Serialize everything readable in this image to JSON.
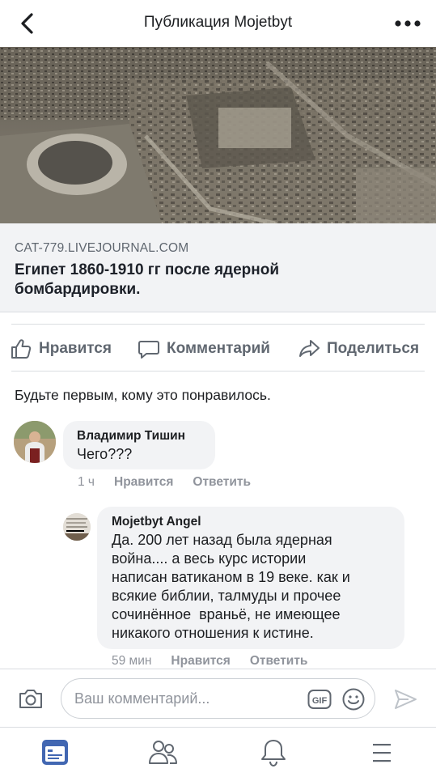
{
  "header": {
    "title": "Публикация Mojetbyt"
  },
  "link_card": {
    "domain": "CAT-779.LIVEJOURNAL.COM",
    "title": "Египет 1860-1910 гг после ядерной бомбардировки."
  },
  "actions": {
    "like": "Нравится",
    "comment": "Комментарий",
    "share": "Поделиться"
  },
  "likes_summary": "Будьте первым, кому это понравилось.",
  "comments": [
    {
      "author": "Владимир Тишин",
      "text": "Чего???",
      "time": "1 ч",
      "like": "Нравится",
      "reply": "Ответить"
    },
    {
      "author": "Mojetbyt Angel",
      "lines": [
        "Да. 200 лет назад была ядерная",
        "война.... а весь курс истории",
        "написан ватиканом в 19 веке. как и",
        "всякие библии, талмуды и прочее",
        "сочинённое  враньё, не имеющее",
        "никакого отношения к истине."
      ],
      "time": "59 мин",
      "like": "Нравится",
      "reply": "Ответить"
    }
  ],
  "composer": {
    "placeholder": "Ваш комментарий..."
  },
  "colors": {
    "accent": "#4267b2",
    "icon_gray": "#606770",
    "bubble": "#f2f3f5"
  }
}
